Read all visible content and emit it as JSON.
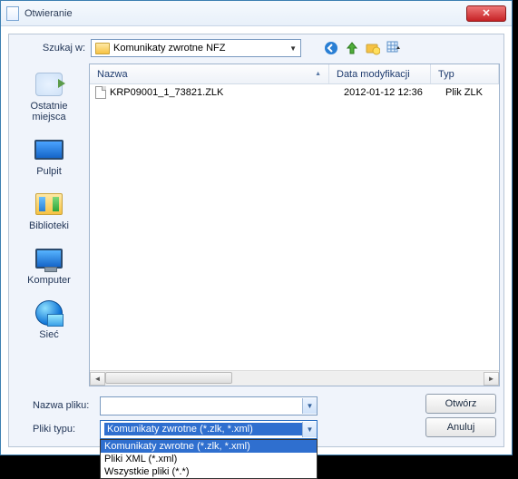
{
  "window": {
    "title": "Otwieranie"
  },
  "toolbar": {
    "lookin_label": "Szukaj w:",
    "path": "Komunikaty zwrotne NFZ"
  },
  "places": {
    "recent": "Ostatnie miejsca",
    "desktop": "Pulpit",
    "libraries": "Biblioteki",
    "computer": "Komputer",
    "network": "Sieć"
  },
  "columns": {
    "name": "Nazwa",
    "date": "Data modyfikacji",
    "type": "Typ"
  },
  "files": [
    {
      "name": "KRP09001_1_73821.ZLK",
      "date": "2012-01-12 12:36",
      "type": "Plik ZLK"
    }
  ],
  "labels": {
    "filename": "Nazwa pliku:",
    "filetype": "Pliki typu:"
  },
  "filename_value": "",
  "filetype_value": "Komunikaty zwrotne (*.zlk, *.xml)",
  "filetype_options": [
    "Komunikaty zwrotne (*.zlk, *.xml)",
    "Pliki XML (*.xml)",
    "Wszystkie pliki (*.*)"
  ],
  "buttons": {
    "open": "Otwórz",
    "cancel": "Anuluj"
  }
}
